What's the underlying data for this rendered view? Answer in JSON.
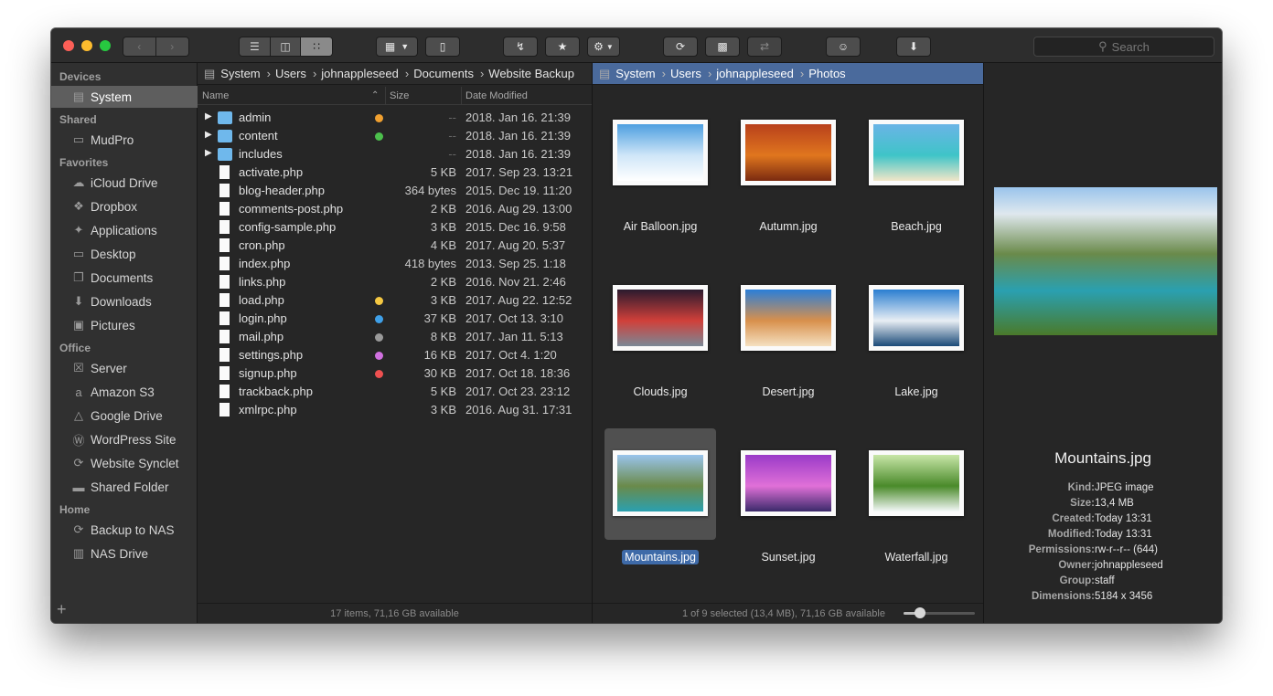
{
  "toolbar": {
    "search_placeholder": "Search"
  },
  "sidebar": {
    "sections": [
      {
        "heading": "Devices",
        "items": [
          {
            "label": "System",
            "icon": "hard-drive-icon",
            "selected": true
          }
        ]
      },
      {
        "heading": "Shared",
        "items": [
          {
            "label": "MudPro",
            "icon": "monitor-icon"
          }
        ]
      },
      {
        "heading": "Favorites",
        "items": [
          {
            "label": "iCloud Drive",
            "icon": "cloud-icon"
          },
          {
            "label": "Dropbox",
            "icon": "dropbox-icon"
          },
          {
            "label": "Applications",
            "icon": "applications-icon"
          },
          {
            "label": "Desktop",
            "icon": "desktop-icon"
          },
          {
            "label": "Documents",
            "icon": "documents-icon"
          },
          {
            "label": "Downloads",
            "icon": "download-icon"
          },
          {
            "label": "Pictures",
            "icon": "camera-icon"
          }
        ]
      },
      {
        "heading": "Office",
        "items": [
          {
            "label": "Server",
            "icon": "lock-icon"
          },
          {
            "label": "Amazon S3",
            "icon": "amazon-icon"
          },
          {
            "label": "Google Drive",
            "icon": "google-drive-icon"
          },
          {
            "label": "WordPress Site",
            "icon": "wordpress-icon"
          },
          {
            "label": "Website Synclet",
            "icon": "sync-icon"
          },
          {
            "label": "Shared Folder",
            "icon": "folder-icon"
          }
        ]
      },
      {
        "heading": "Home",
        "items": [
          {
            "label": "Backup to NAS",
            "icon": "sync-icon"
          },
          {
            "label": "NAS Drive",
            "icon": "nas-icon"
          }
        ]
      }
    ]
  },
  "left_pane": {
    "breadcrumb": [
      "System",
      "Users",
      "johnappleseed",
      "Documents",
      "Website Backup"
    ],
    "columns": {
      "name": "Name",
      "size": "Size",
      "date": "Date Modified"
    },
    "rows": [
      {
        "name": "admin",
        "type": "folder",
        "size": "--",
        "date": "2018. Jan 16. 21:39",
        "tag": "#f0a030"
      },
      {
        "name": "content",
        "type": "folder",
        "size": "--",
        "date": "2018. Jan 16. 21:39",
        "tag": "#4cc04c"
      },
      {
        "name": "includes",
        "type": "folder",
        "size": "--",
        "date": "2018. Jan 16. 21:39",
        "tag": ""
      },
      {
        "name": "activate.php",
        "type": "file",
        "size": "5 KB",
        "date": "2017. Sep 23. 13:21",
        "tag": ""
      },
      {
        "name": "blog-header.php",
        "type": "file",
        "size": "364 bytes",
        "date": "2015. Dec 19. 11:20",
        "tag": ""
      },
      {
        "name": "comments-post.php",
        "type": "file",
        "size": "2 KB",
        "date": "2016. Aug 29. 13:00",
        "tag": ""
      },
      {
        "name": "config-sample.php",
        "type": "file",
        "size": "3 KB",
        "date": "2015. Dec 16. 9:58",
        "tag": ""
      },
      {
        "name": "cron.php",
        "type": "file",
        "size": "4 KB",
        "date": "2017. Aug 20. 5:37",
        "tag": ""
      },
      {
        "name": "index.php",
        "type": "file",
        "size": "418 bytes",
        "date": "2013. Sep 25. 1:18",
        "tag": ""
      },
      {
        "name": "links.php",
        "type": "file",
        "size": "2 KB",
        "date": "2016. Nov 21. 2:46",
        "tag": ""
      },
      {
        "name": "load.php",
        "type": "file",
        "size": "3 KB",
        "date": "2017. Aug 22. 12:52",
        "tag": "#f5c842"
      },
      {
        "name": "login.php",
        "type": "file",
        "size": "37 KB",
        "date": "2017. Oct 13. 3:10",
        "tag": "#3fa0e8"
      },
      {
        "name": "mail.php",
        "type": "file",
        "size": "8 KB",
        "date": "2017. Jan 11. 5:13",
        "tag": "#9a9a9a"
      },
      {
        "name": "settings.php",
        "type": "file",
        "size": "16 KB",
        "date": "2017. Oct 4. 1:20",
        "tag": "#d070e0"
      },
      {
        "name": "signup.php",
        "type": "file",
        "size": "30 KB",
        "date": "2017. Oct 18. 18:36",
        "tag": "#ee5050"
      },
      {
        "name": "trackback.php",
        "type": "file",
        "size": "5 KB",
        "date": "2017. Oct 23. 23:12",
        "tag": ""
      },
      {
        "name": "xmlrpc.php",
        "type": "file",
        "size": "3 KB",
        "date": "2016. Aug 31. 17:31",
        "tag": ""
      }
    ],
    "status": "17 items, 71,16 GB available"
  },
  "right_pane": {
    "breadcrumb": [
      "System",
      "Users",
      "johnappleseed",
      "Photos"
    ],
    "photos": [
      {
        "name": "Air Balloon.jpg",
        "colors": [
          "#4d9fe0",
          "#cfe6f8",
          "#ffffff"
        ]
      },
      {
        "name": "Autumn.jpg",
        "colors": [
          "#b8401c",
          "#e0761e",
          "#7a2a10"
        ]
      },
      {
        "name": "Beach.jpg",
        "colors": [
          "#6ab4e6",
          "#3fc4c8",
          "#f2e6c8"
        ]
      },
      {
        "name": "Clouds.jpg",
        "colors": [
          "#2a1a2e",
          "#d0403a",
          "#7a8896"
        ]
      },
      {
        "name": "Desert.jpg",
        "colors": [
          "#2a7ed8",
          "#d8904c",
          "#f4e0c0"
        ]
      },
      {
        "name": "Lake.jpg",
        "colors": [
          "#2a7ed0",
          "#e8eef4",
          "#1a4a78"
        ]
      },
      {
        "name": "Mountains.jpg",
        "colors": [
          "#9ac4ec",
          "#6a8a4a",
          "#2aa0b0"
        ],
        "selected": true
      },
      {
        "name": "Sunset.jpg",
        "colors": [
          "#9a3ac8",
          "#e070d8",
          "#3a2a6a"
        ]
      },
      {
        "name": "Waterfall.jpg",
        "colors": [
          "#c8e6a8",
          "#4a8a2a",
          "#f4f8f8"
        ]
      }
    ],
    "status": "1 of 9 selected (13,4 MB), 71,16 GB available",
    "thumbnail_size_fraction": 0.2
  },
  "preview": {
    "title": "Mountains.jpg",
    "info": [
      {
        "key": "Kind:",
        "value": "JPEG image"
      },
      {
        "key": "Size:",
        "value": "13,4 MB"
      },
      {
        "key": "Created:",
        "value": "Today 13:31"
      },
      {
        "key": "Modified:",
        "value": "Today 13:31"
      },
      {
        "key": "Permissions:",
        "value": "rw-r--r-- (644)"
      },
      {
        "key": "Owner:",
        "value": "johnappleseed"
      },
      {
        "key": "Group:",
        "value": "staff"
      },
      {
        "key": "Dimensions:",
        "value": "5184 x 3456"
      }
    ]
  }
}
